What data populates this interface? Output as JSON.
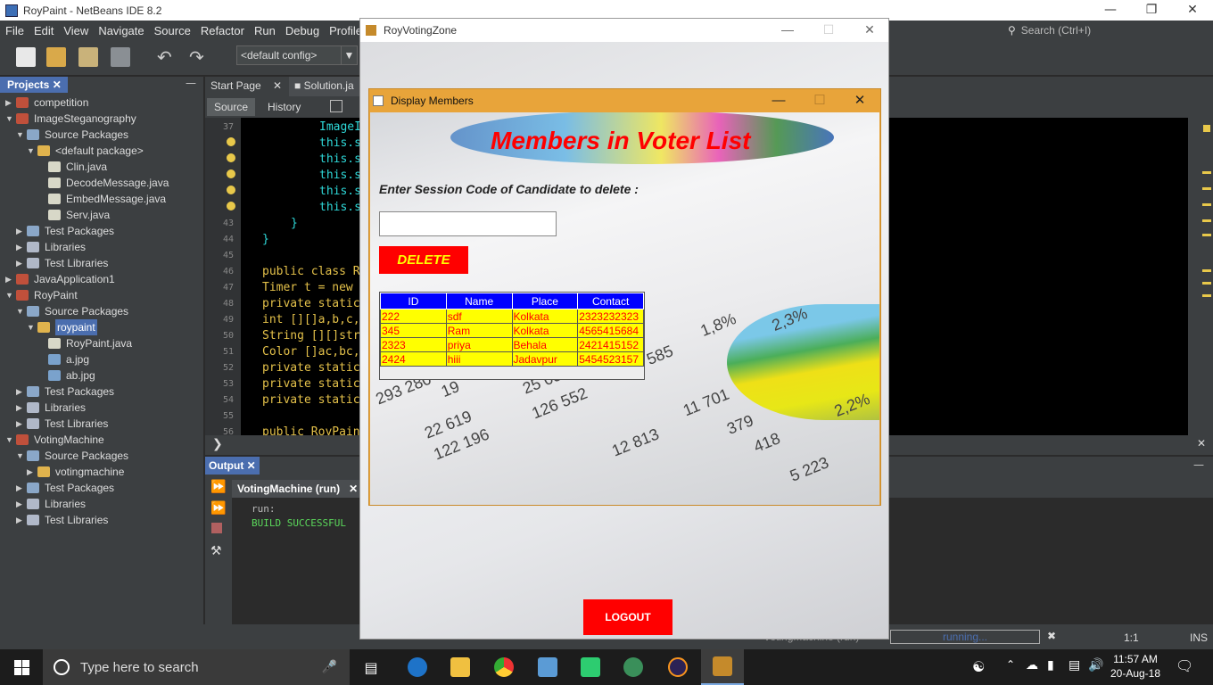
{
  "ide": {
    "title": "RoyPaint - NetBeans IDE 8.2",
    "window_controls": [
      "—",
      "❐",
      "✕"
    ],
    "menu": [
      "File",
      "Edit",
      "View",
      "Navigate",
      "Source",
      "Refactor",
      "Run",
      "Debug",
      "Profile"
    ],
    "search_placeholder": "Search (Ctrl+I)",
    "config": "<default config>",
    "projects_tab": "Projects",
    "editor_tabs": [
      "Start Page",
      "Solution.ja"
    ],
    "editor_subtabs": [
      "Source",
      "History"
    ],
    "line_numbers": [
      "37",
      "",
      "",
      "",
      "",
      "",
      "43",
      "44",
      "45",
      "46",
      "47",
      "48",
      "49",
      "50",
      "51",
      "52",
      "53",
      "54",
      "55",
      "56"
    ],
    "code_lines": [
      "ImageI",
      "this.s",
      "this.s",
      "this.s",
      "this.s",
      "this.s",
      "}",
      "}",
      "",
      "public class R",
      "Timer t = new",
      "private static",
      "int [][]a,b,c,",
      "String [][]str",
      "Color []ac,bc,",
      "private static",
      "private static",
      "private static",
      "",
      "public RoyPain"
    ],
    "output_tab": "Output",
    "output_run_tab": "VotingMachine (run)",
    "output_lines": [
      "run:",
      "BUILD SUCCESSFUL"
    ],
    "status_task": "VotingMachine (run)",
    "status_progress": "running...",
    "status_pos": "1:1",
    "status_mode": "INS"
  },
  "tree": [
    {
      "label": "competition",
      "depth": 0,
      "icon": "project",
      "tw": "▶"
    },
    {
      "label": "ImageSteganography",
      "depth": 0,
      "icon": "project",
      "tw": "▼"
    },
    {
      "label": "Source Packages",
      "depth": 1,
      "icon": "package",
      "tw": "▼"
    },
    {
      "label": "<default package>",
      "depth": 2,
      "icon": "defpkg",
      "tw": "▼"
    },
    {
      "label": "Clin.java",
      "depth": 3,
      "icon": "java",
      "tw": ""
    },
    {
      "label": "DecodeMessage.java",
      "depth": 3,
      "icon": "java",
      "tw": ""
    },
    {
      "label": "EmbedMessage.java",
      "depth": 3,
      "icon": "java",
      "tw": ""
    },
    {
      "label": "Serv.java",
      "depth": 3,
      "icon": "java",
      "tw": ""
    },
    {
      "label": "Test Packages",
      "depth": 1,
      "icon": "package",
      "tw": "▶"
    },
    {
      "label": "Libraries",
      "depth": 1,
      "icon": "lib",
      "tw": "▶"
    },
    {
      "label": "Test Libraries",
      "depth": 1,
      "icon": "lib",
      "tw": "▶"
    },
    {
      "label": "JavaApplication1",
      "depth": 0,
      "icon": "project",
      "tw": "▶"
    },
    {
      "label": "RoyPaint",
      "depth": 0,
      "icon": "project",
      "tw": "▼"
    },
    {
      "label": "Source Packages",
      "depth": 1,
      "icon": "package",
      "tw": "▼"
    },
    {
      "label": "roypaint",
      "depth": 2,
      "icon": "defpkg",
      "tw": "▼",
      "selected": true
    },
    {
      "label": "RoyPaint.java",
      "depth": 3,
      "icon": "java",
      "tw": ""
    },
    {
      "label": "a.jpg",
      "depth": 3,
      "icon": "img",
      "tw": ""
    },
    {
      "label": "ab.jpg",
      "depth": 3,
      "icon": "img",
      "tw": ""
    },
    {
      "label": "Test Packages",
      "depth": 1,
      "icon": "package",
      "tw": "▶"
    },
    {
      "label": "Libraries",
      "depth": 1,
      "icon": "lib",
      "tw": "▶"
    },
    {
      "label": "Test Libraries",
      "depth": 1,
      "icon": "lib",
      "tw": "▶"
    },
    {
      "label": "VotingMachine",
      "depth": 0,
      "icon": "project",
      "tw": "▼"
    },
    {
      "label": "Source Packages",
      "depth": 1,
      "icon": "package",
      "tw": "▼"
    },
    {
      "label": "votingmachine",
      "depth": 2,
      "icon": "defpkg",
      "tw": "▶"
    },
    {
      "label": "Test Packages",
      "depth": 1,
      "icon": "package",
      "tw": "▶"
    },
    {
      "label": "Libraries",
      "depth": 1,
      "icon": "lib",
      "tw": "▶"
    },
    {
      "label": "Test Libraries",
      "depth": 1,
      "icon": "lib",
      "tw": "▶"
    }
  ],
  "voting_window": {
    "title": "RoyVotingZone",
    "logout_label": "LOGOUT"
  },
  "members_dialog": {
    "title": "Display Members",
    "heading": "Members in Voter List",
    "prompt": "Enter Session Code of Candidate to delete :",
    "session_input_value": "",
    "delete_label": "DELETE",
    "columns": [
      "ID",
      "Name",
      "Place",
      "Contact"
    ],
    "rows": [
      [
        "222",
        "sdf",
        "Kolkata",
        "2323232323"
      ],
      [
        "345",
        "Ram",
        "Kolkata",
        "4565415684"
      ],
      [
        "2323",
        "priya",
        "Behala",
        "2421415152"
      ],
      [
        "2424",
        "hiii",
        "Jadavpur",
        "5454523157"
      ]
    ],
    "background_numbers": [
      "293 280",
      "19",
      "25 031",
      "126 552",
      "22 619",
      "122 196",
      "12 813",
      "11 701",
      "379",
      "418",
      "5 223",
      "2,2%",
      "1,8%",
      "2,3%",
      "585"
    ]
  },
  "taskbar": {
    "search_placeholder": "Type here to search",
    "time": "11:57 AM",
    "date": "20-Aug-18"
  },
  "colors": {
    "accent_blue": "#4b6eaf",
    "dialog_frame": "#e8a43a",
    "danger_red": "#ff0000",
    "table_header": "#0000ff",
    "table_cell": "#ffff00"
  }
}
